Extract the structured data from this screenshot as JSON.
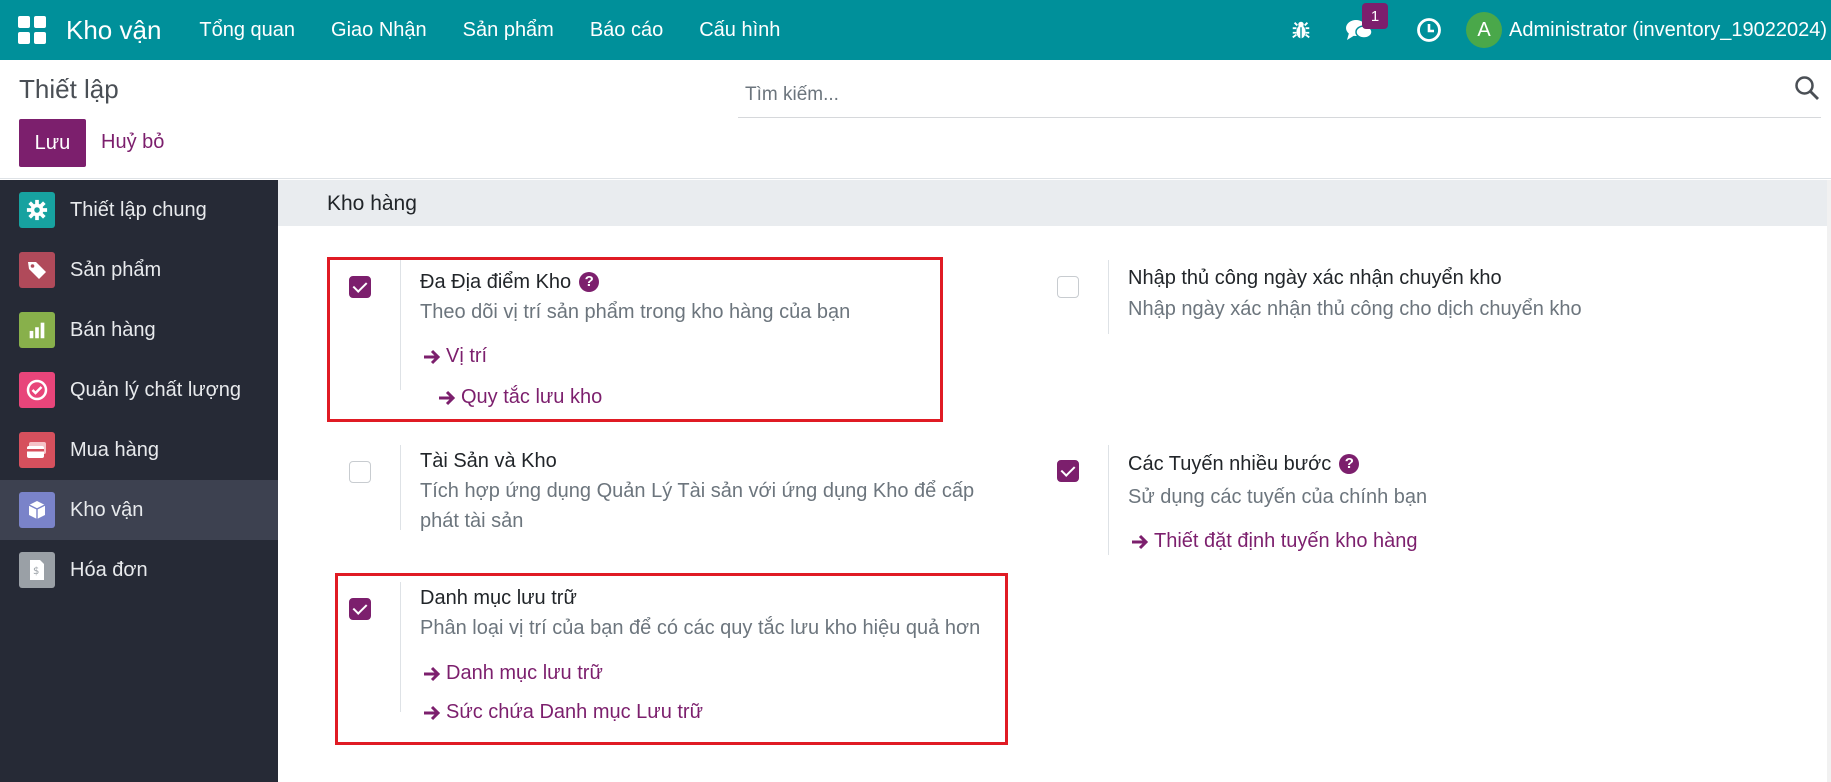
{
  "topbar": {
    "brand": "Kho vận",
    "menu": [
      "Tổng quan",
      "Giao Nhận",
      "Sản phẩm",
      "Báo cáo",
      "Cấu hình"
    ],
    "chat_badge": "1",
    "avatar_letter": "A",
    "user_name": "Administrator (inventory_19022024)"
  },
  "control_panel": {
    "title": "Thiết lập",
    "save_label": "Lưu",
    "discard_label": "Huỷ bỏ",
    "search_placeholder": "Tìm kiếm..."
  },
  "sidebar": {
    "items": [
      {
        "label": "Thiết lập chung",
        "icon": "gear-icon",
        "color": "#17a2a0",
        "active": false
      },
      {
        "label": "Sản phẩm",
        "icon": "tags-icon",
        "color": "#b04a5a",
        "active": false
      },
      {
        "label": "Bán hàng",
        "icon": "chart-icon",
        "color": "#88b04b",
        "active": false
      },
      {
        "label": "Quản lý chất lượng",
        "icon": "check-circle-icon",
        "color": "#e8457a",
        "active": false
      },
      {
        "label": "Mua hàng",
        "icon": "card-icon",
        "color": "#d6505d",
        "active": false
      },
      {
        "label": "Kho vận",
        "icon": "box-icon",
        "color": "#7a83c9",
        "active": true
      },
      {
        "label": "Hóa đơn",
        "icon": "invoice-icon",
        "color": "#9aa0a6",
        "active": false
      }
    ]
  },
  "section": {
    "title": "Kho hàng"
  },
  "settings": {
    "multi_location": {
      "title": "Đa Địa điểm Kho",
      "desc": "Theo dõi vị trí sản phẩm trong kho hàng của bạn",
      "checked": true,
      "links": [
        "Vị trí",
        "Quy tắc lưu kho"
      ]
    },
    "manual_date": {
      "title": "Nhập thủ công ngày xác nhận chuyển kho",
      "desc": "Nhập ngày xác nhận thủ công cho dịch chuyển kho",
      "checked": false
    },
    "assets": {
      "title": "Tài Sản và Kho",
      "desc": "Tích hợp ứng dụng Quản Lý Tài sản với ứng dụng Kho để cấp phát tài sản",
      "checked": false
    },
    "multi_step": {
      "title": "Các Tuyến nhiều bước",
      "desc": "Sử dụng các tuyến của chính bạn",
      "checked": true,
      "links": [
        "Thiết đặt định tuyến kho hàng"
      ]
    },
    "storage_categories": {
      "title": "Danh mục lưu trữ",
      "desc": "Phân loại vị trí của bạn để có các quy tắc lưu kho hiệu quả hơn",
      "checked": true,
      "links": [
        "Danh mục lưu trữ",
        "Sức chứa Danh mục Lưu trữ"
      ]
    }
  },
  "colors": {
    "navbar": "#00909a",
    "brand": "#7c1f6d",
    "highlight": "#e01b24",
    "sidebar": "#262a36"
  }
}
